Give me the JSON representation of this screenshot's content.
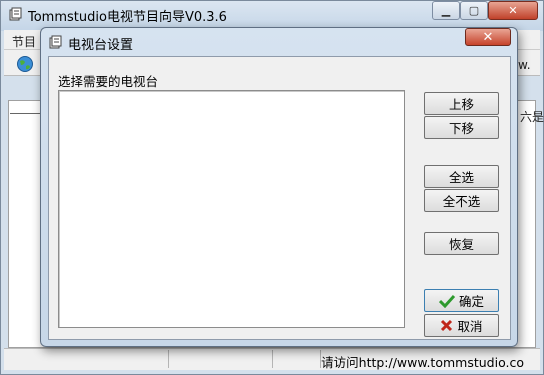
{
  "main_window": {
    "title": "Tommstudio电视节目向导V0.3.6",
    "menu_peek": "节目",
    "toolbar_peek": "w.",
    "side_peek": "六是",
    "status_text": "请访问http://www.tommstudio.co"
  },
  "dialog": {
    "title": "电视台设置",
    "label": "选择需要的电视台",
    "stations": [],
    "buttons": {
      "move_up": "上移",
      "move_down": "下移",
      "select_all": "全选",
      "select_none": "全不选",
      "restore": "恢复",
      "ok": "确定",
      "cancel": "取消"
    }
  },
  "icons": [
    "app-icon",
    "globe-icon",
    "checkmark-icon",
    "cross-icon"
  ],
  "colors": {
    "ok_check": "#2e9a2e",
    "cancel_x": "#c0261a",
    "close_button": "#c6432b"
  }
}
